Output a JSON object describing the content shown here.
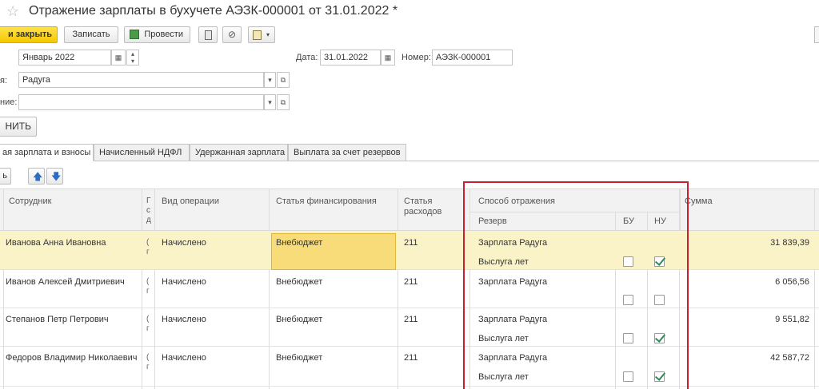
{
  "window": {
    "title": "Отражение зарплаты в бухучете АЭЗК-000001 от 31.01.2022 *"
  },
  "toolbar": {
    "post_close_label": "и закрыть",
    "save_label": "Записать",
    "post_label": "Провести"
  },
  "form": {
    "month_value": "Январь 2022",
    "date_label": "Дата:",
    "date_value": "31.01.2022",
    "number_label": "Номер:",
    "number_value": "АЭЗК-000001",
    "org_label": "я:",
    "org_value": "Радуга",
    "dept_label": "ние:",
    "dept_value": "",
    "fill_label": "НИТЬ"
  },
  "tabs": [
    {
      "label": "ая зарплата и взносы"
    },
    {
      "label": "Начисленный НДФЛ"
    },
    {
      "label": "Удержанная зарплата"
    },
    {
      "label": "Выплата за счет резервов"
    }
  ],
  "table_toolbar": {
    "add_label": "ь"
  },
  "table": {
    "headers": {
      "employee": "Сотрудник",
      "narrow": "Г\nс\nд",
      "operation": "Вид операции",
      "funding": "Статья финансирования",
      "expense": "Статья\nрасходов",
      "method": "Способ отражения",
      "reserve": "Резерв",
      "bu": "БУ",
      "nu": "НУ",
      "sum": "Сумма"
    },
    "rows": [
      {
        "employee": "Иванова Анна Ивановна",
        "narrow": "(\nг",
        "operation": "Начислено",
        "funding": "Внебюджет",
        "expense": "211",
        "method": "Зарплата Радуга",
        "reserve": "Выслуга лет",
        "bu": false,
        "nu": true,
        "sum": "31 839,39",
        "selected": true
      },
      {
        "employee": "Иванов Алексей Дмитриевич",
        "narrow": "(\nг",
        "operation": "Начислено",
        "funding": "Внебюджет",
        "expense": "211",
        "method": "Зарплата Радуга",
        "reserve": "",
        "bu": false,
        "nu": false,
        "sum": "6 056,56",
        "selected": false
      },
      {
        "employee": "Степанов Петр Петрович",
        "narrow": "(\nг",
        "operation": "Начислено",
        "funding": "Внебюджет",
        "expense": "211",
        "method": "Зарплата Радуга",
        "reserve": "Выслуга лет",
        "bu": false,
        "nu": true,
        "sum": "9 551,82",
        "selected": false
      },
      {
        "employee": "Федоров Владимир Николаевич",
        "narrow": "(\nг",
        "operation": "Начислено",
        "funding": "Внебюджет",
        "expense": "211",
        "method": "Зарплата Радуга",
        "reserve": "Выслуга лет",
        "bu": false,
        "nu": true,
        "sum": "42 587,72",
        "selected": false
      }
    ]
  },
  "colors": {
    "accent_yellow": "#f5c800",
    "selected_row": "#fbf3c8",
    "highlight_box": "#c8202f"
  }
}
